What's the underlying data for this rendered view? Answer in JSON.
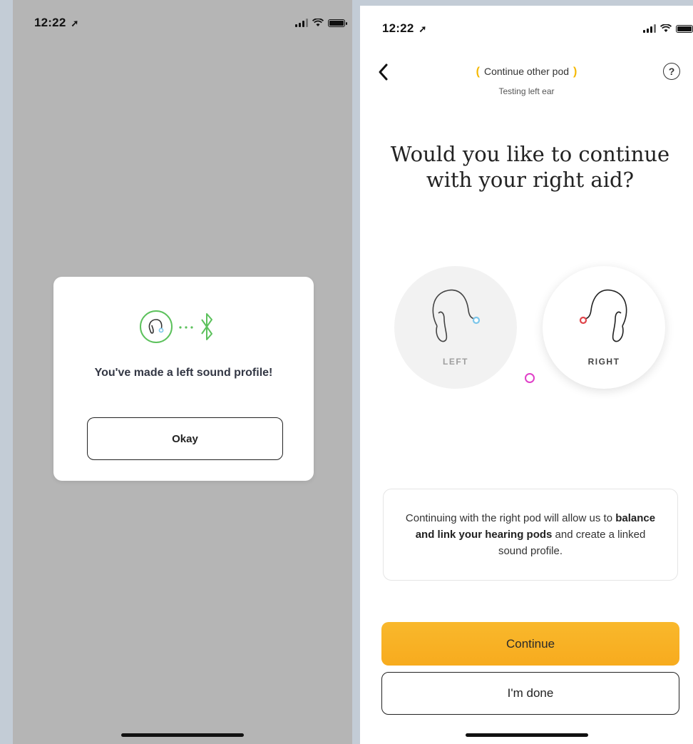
{
  "left_screen": {
    "status_time": "12:22",
    "modal": {
      "title": "You've made a left sound profile!",
      "okay_label": "Okay"
    }
  },
  "right_screen": {
    "status_time": "12:22",
    "nav": {
      "title": "Continue other pod",
      "subtitle": "Testing left ear",
      "help_label": "?"
    },
    "question": "Would you like to continue with your right aid?",
    "pods": {
      "left_label": "LEFT",
      "right_label": "RIGHT"
    },
    "info": {
      "text_1": "Continuing with the right pod will allow us to ",
      "bold_1": "balance and link your hearing pods",
      "text_2": " and create a linked sound profile."
    },
    "continue_label": "Continue",
    "done_label": "I'm done"
  },
  "colors": {
    "accent_yellow": "#f7ab1e",
    "bluetooth_green": "#5cc15c",
    "left_ear_blue": "#7cc6ea",
    "right_ear_red": "#e0444a",
    "marker_pink": "#e040c8"
  }
}
